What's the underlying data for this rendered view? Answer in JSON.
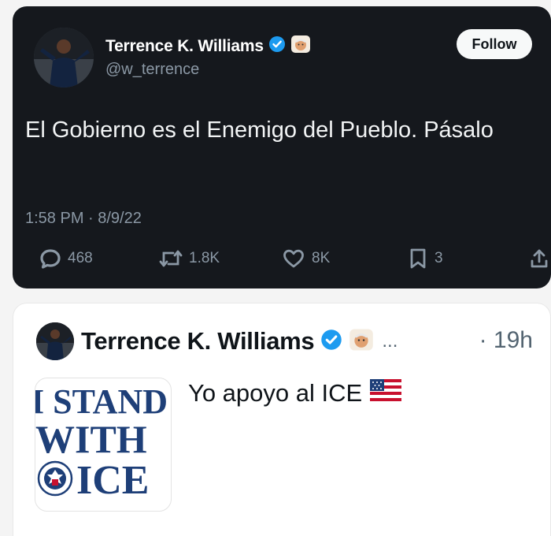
{
  "tweet_dark": {
    "author_name": "Terrence K. Williams",
    "handle": "@w_terrence",
    "follow_label": "Follow",
    "text": "El Gobierno es el Enemigo del Pueblo. Pásalo",
    "timestamp": "1:58 PM · 8/9/22",
    "replies": "468",
    "retweets": "1.8K",
    "likes": "8K",
    "bookmarks": "3",
    "icons": [
      "verified-badge-icon",
      "emoji-badge-icon",
      "reply-icon",
      "retweet-icon",
      "like-icon",
      "bookmark-icon",
      "share-icon"
    ],
    "colors": {
      "background": "#15181d",
      "text": "#e7e9ea",
      "muted": "#8b98a5",
      "verified": "#1d9bf0"
    }
  },
  "tweet_light": {
    "author_name": "Terrence K. Williams",
    "ellipsis": "...",
    "time": "· 19h",
    "text": "Yo apoyo al ICE",
    "image_lines": [
      "I STAND",
      "WITH",
      "ICE"
    ],
    "icons": [
      "verified-badge-icon",
      "emoji-badge-icon",
      "us-flag-icon",
      "dhs-seal-icon"
    ],
    "colors": {
      "background": "#ffffff",
      "text": "#0f1419",
      "muted": "#536471",
      "image_text": "#1e3f78"
    }
  }
}
